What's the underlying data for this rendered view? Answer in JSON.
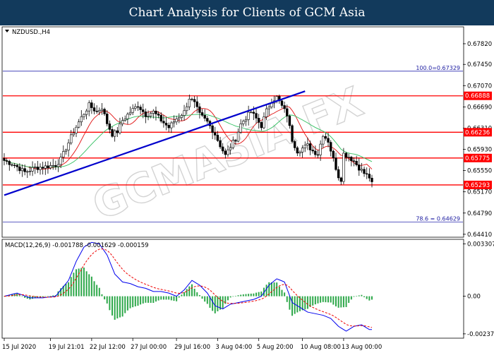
{
  "header": {
    "title": "Chart Analysis for Clients of GCM Asia"
  },
  "price_panel": {
    "symbol_label": "NZDUSD.,H4",
    "watermark": "GCMASIA FX",
    "fib_levels": [
      {
        "label": "100.0=0.67329",
        "value": 0.67329
      },
      {
        "label": "78.6 = 0.64629",
        "value": 0.64629
      }
    ],
    "levels": [
      {
        "label": "0.66888",
        "value": 0.66888
      },
      {
        "label": "0.66236",
        "value": 0.66236
      },
      {
        "label": "0.65775",
        "value": 0.65775
      },
      {
        "label": "0.65293",
        "value": 0.65293
      }
    ],
    "colors": {
      "level_line": "#ff0000",
      "fib_line": "#2b2bb0",
      "trend_line": "#0000cc",
      "ma_fast": "#e01010",
      "ma_slow": "#30c060",
      "candle": "#000000"
    }
  },
  "macd_panel": {
    "label": "MACD(12,26,9) -0.001788 -0.001629 -0.000159",
    "colors": {
      "macd": "#0000ee",
      "signal": "#ee0000",
      "histogram": "#2ea84a"
    }
  },
  "chart_data": {
    "type": "candlestick",
    "price_axis": {
      "ticks": [
        0.6782,
        0.6745,
        0.6707,
        0.6669,
        0.6631,
        0.6593,
        0.6555,
        0.6517,
        0.6479,
        0.6441
      ],
      "tick_labels": [
        "0.67820",
        "0.67450",
        "0.67070",
        "0.66690",
        "0.66310",
        "0.65930",
        "0.65550",
        "0.65170",
        "0.64790",
        "0.64410"
      ],
      "range": [
        0.6437,
        0.6811
      ]
    },
    "macd_axis": {
      "tick_labels": [
        "0.003307",
        "0.00",
        "-0.002372"
      ],
      "ticks": [
        0.003307,
        0.0,
        -0.002372
      ],
      "range": [
        -0.0026,
        0.0035
      ]
    },
    "time_labels": [
      "15 Jul 2020",
      "19 Jul 21:01",
      "22 Jul 12:00",
      "27 Jul 00:00",
      "29 Jul 16:00",
      "3 Aug 04:00",
      "5 Aug 20:00",
      "10 Aug 08:00",
      "13 Aug 00:00"
    ],
    "time_label_bars": [
      0,
      18,
      34,
      50,
      67,
      83,
      99,
      116,
      132
    ],
    "bar_count": 144,
    "close_anchors": [
      [
        0,
        0.6573
      ],
      [
        4,
        0.6565
      ],
      [
        8,
        0.6552
      ],
      [
        12,
        0.656
      ],
      [
        16,
        0.6562
      ],
      [
        20,
        0.6565
      ],
      [
        22,
        0.6575
      ],
      [
        25,
        0.6605
      ],
      [
        27,
        0.6625
      ],
      [
        30,
        0.665
      ],
      [
        33,
        0.6672
      ],
      [
        36,
        0.666
      ],
      [
        38,
        0.6668
      ],
      [
        40,
        0.664
      ],
      [
        42,
        0.662
      ],
      [
        44,
        0.6625
      ],
      [
        46,
        0.6645
      ],
      [
        49,
        0.666
      ],
      [
        52,
        0.6672
      ],
      [
        55,
        0.6655
      ],
      [
        58,
        0.666
      ],
      [
        61,
        0.6645
      ],
      [
        64,
        0.6632
      ],
      [
        67,
        0.6648
      ],
      [
        70,
        0.666
      ],
      [
        72,
        0.6685
      ],
      [
        74,
        0.6675
      ],
      [
        76,
        0.6655
      ],
      [
        79,
        0.6642
      ],
      [
        82,
        0.662
      ],
      [
        84,
        0.66
      ],
      [
        86,
        0.6582
      ],
      [
        88,
        0.6598
      ],
      [
        90,
        0.6612
      ],
      [
        92,
        0.6638
      ],
      [
        94,
        0.665
      ],
      [
        96,
        0.666
      ],
      [
        98,
        0.6648
      ],
      [
        100,
        0.6635
      ],
      [
        102,
        0.6662
      ],
      [
        104,
        0.668
      ],
      [
        106,
        0.6686
      ],
      [
        108,
        0.667
      ],
      [
        110,
        0.6655
      ],
      [
        112,
        0.661
      ],
      [
        114,
        0.659
      ],
      [
        116,
        0.6595
      ],
      [
        118,
        0.66
      ],
      [
        120,
        0.659
      ],
      [
        122,
        0.6585
      ],
      [
        124,
        0.662
      ],
      [
        126,
        0.6608
      ],
      [
        128,
        0.6575
      ],
      [
        130,
        0.6545
      ],
      [
        131,
        0.654
      ],
      [
        132,
        0.6585
      ],
      [
        134,
        0.658
      ],
      [
        136,
        0.6572
      ],
      [
        138,
        0.656
      ],
      [
        140,
        0.655
      ],
      [
        142,
        0.6543
      ],
      [
        143,
        0.6531
      ]
    ],
    "trend_line": {
      "start": [
        0,
        0.6511
      ],
      "end": [
        117,
        0.6697
      ]
    },
    "macd_anchors": [
      [
        0,
        0.0
      ],
      [
        5,
        0.0002
      ],
      [
        10,
        -0.0001
      ],
      [
        15,
        -0.0001
      ],
      [
        20,
        0.0
      ],
      [
        25,
        0.001
      ],
      [
        28,
        0.0022
      ],
      [
        31,
        0.0031
      ],
      [
        34,
        0.0034
      ],
      [
        37,
        0.0033
      ],
      [
        40,
        0.0026
      ],
      [
        43,
        0.0014
      ],
      [
        46,
        0.0009
      ],
      [
        49,
        0.0008
      ],
      [
        52,
        0.0006
      ],
      [
        55,
        0.0005
      ],
      [
        58,
        0.0003
      ],
      [
        61,
        0.0003
      ],
      [
        64,
        0.0002
      ],
      [
        67,
        0.0
      ],
      [
        70,
        0.0004
      ],
      [
        73,
        0.001
      ],
      [
        76,
        0.0007
      ],
      [
        79,
        0.0002
      ],
      [
        82,
        -0.0006
      ],
      [
        85,
        -0.0008
      ],
      [
        88,
        -0.0005
      ],
      [
        91,
        -0.0004
      ],
      [
        94,
        -0.0003
      ],
      [
        97,
        -0.0002
      ],
      [
        100,
        0.0
      ],
      [
        103,
        0.0007
      ],
      [
        106,
        0.0011
      ],
      [
        109,
        0.0009
      ],
      [
        112,
        -0.0004
      ],
      [
        115,
        -0.0007
      ],
      [
        118,
        -0.001
      ],
      [
        121,
        -0.0011
      ],
      [
        124,
        -0.0012
      ],
      [
        127,
        -0.0014
      ],
      [
        130,
        -0.0019
      ],
      [
        133,
        -0.0022
      ],
      [
        136,
        -0.0019
      ],
      [
        139,
        -0.0018
      ],
      [
        142,
        -0.0021
      ],
      [
        143,
        -0.0021
      ]
    ]
  }
}
